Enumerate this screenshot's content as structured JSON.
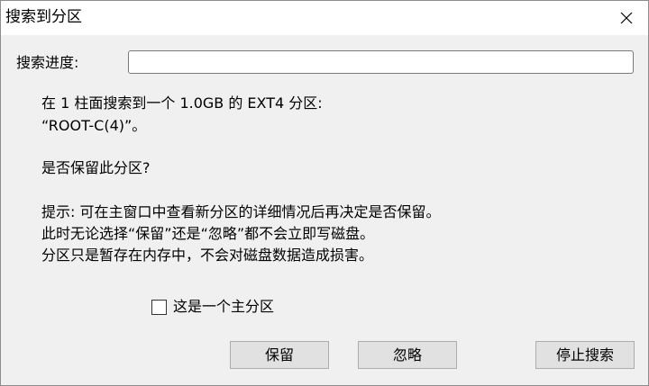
{
  "window": {
    "title": "搜索到分区",
    "close_icon": "close-icon"
  },
  "progress": {
    "label": "搜索进度:",
    "value": ""
  },
  "message": {
    "line1": "在 1 柱面搜索到一个 1.0GB 的 EXT4 分区:",
    "line2": "“ROOT-C(4)”。",
    "question": "是否保留此分区?",
    "hint1": "提示: 可在主窗口中查看新分区的详细情况后再决定是否保留。",
    "hint2": "此时无论选择“保留”还是“忽略”都不会立即写磁盘。",
    "hint3": "分区只是暂存在内存中，不会对磁盘数据造成损害。"
  },
  "checkbox": {
    "label": "这是一个主分区",
    "checked": false
  },
  "buttons": {
    "keep": "保留",
    "ignore": "忽略",
    "stop": "停止搜索"
  }
}
